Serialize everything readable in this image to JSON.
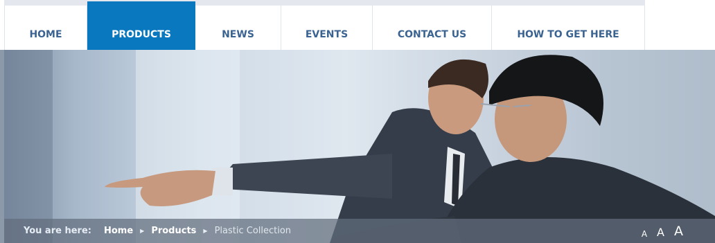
{
  "nav": {
    "items": [
      {
        "label": "HOME"
      },
      {
        "label": "PRODUCTS"
      },
      {
        "label": "NEWS"
      },
      {
        "label": "EVENTS"
      },
      {
        "label": "CONTACT US"
      },
      {
        "label": "HOW TO GET HERE"
      }
    ],
    "active": "PRODUCTS"
  },
  "breadcrumb": {
    "lead": "You are here:",
    "items": [
      {
        "label": "Home"
      },
      {
        "label": "Products"
      }
    ],
    "current": "Plastic Collection"
  },
  "text_size_controls": {
    "small": "A",
    "medium": "A",
    "large": "A"
  },
  "colors": {
    "accent": "#0a78bf",
    "nav_text": "#3a6391"
  },
  "hero": {
    "image": "two-businessmen-pointing"
  }
}
